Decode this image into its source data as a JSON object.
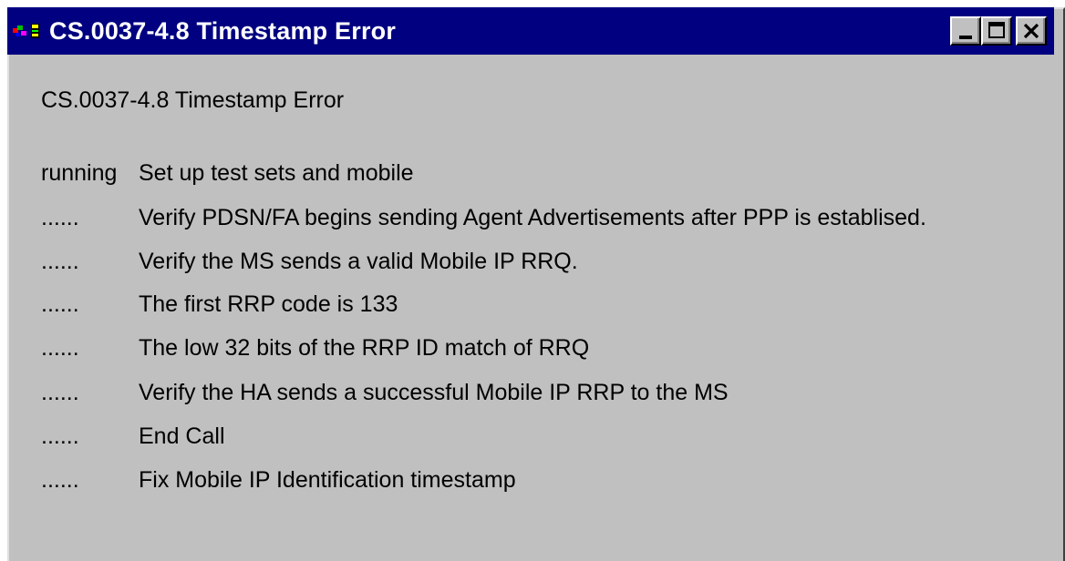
{
  "window": {
    "title": "CS.0037-4.8 Timestamp Error",
    "buttons": {
      "minimize": "minimize-icon",
      "maximize": "maximize-icon",
      "close": "close-icon"
    },
    "colors": {
      "titlebar": "#000080",
      "face": "#c0c0c0"
    }
  },
  "main": {
    "heading": "CS.0037-4.8 Timestamp Error",
    "steps": [
      {
        "status": "running",
        "text": "Set up test sets and mobile"
      },
      {
        "status": "......",
        "text": "Verify PDSN/FA begins sending Agent Advertisements after PPP is establised."
      },
      {
        "status": "......",
        "text": "Verify the MS sends a valid Mobile IP RRQ."
      },
      {
        "status": "......",
        "text": "The first RRP code is 133"
      },
      {
        "status": "......",
        "text": "The low 32 bits of the RRP ID match of RRQ"
      },
      {
        "status": "......",
        "text": "Verify the HA sends a successful Mobile IP RRP to the MS"
      },
      {
        "status": "......",
        "text": "End Call"
      },
      {
        "status": "......",
        "text": "Fix Mobile IP Identification timestamp"
      }
    ]
  }
}
